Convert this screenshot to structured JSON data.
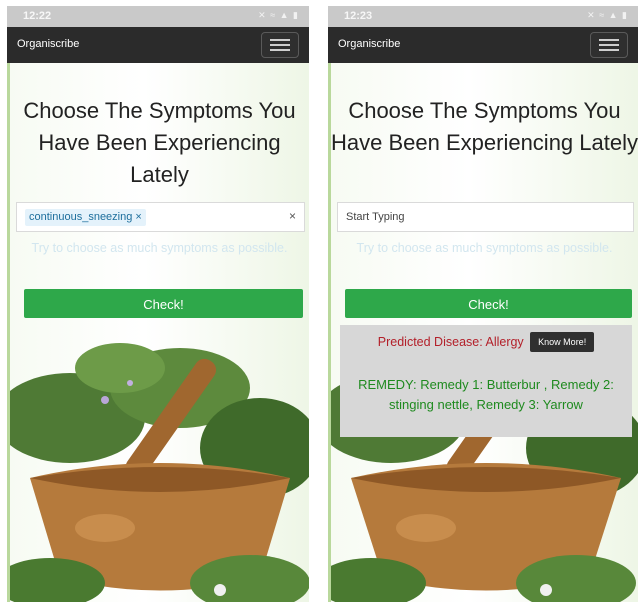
{
  "left_screen": {
    "status_time": "12:22",
    "brand": "Organiscribe",
    "heading": "Choose The Symptoms You Have Been Experiencing Lately",
    "selected_symptom": "continuous_sneezing ×",
    "clear_symbol": "×",
    "hint": "Try to choose as much symptoms as possible.",
    "check_label": "Check!"
  },
  "right_screen": {
    "status_time": "12:23",
    "brand": "Organiscribe",
    "heading": "Choose The Symptoms You Have Been Experiencing Lately",
    "placeholder": "Start Typing",
    "hint": "Try to choose as much symptoms as possible.",
    "check_label": "Check!",
    "predicted_disease": "Predicted Disease: Allergy",
    "know_more_label": "Know More!",
    "remedy": "REMEDY: Remedy 1: Butterbur , Remedy 2: stinging nettle, Remedy 3: Yarrow"
  },
  "icons": {
    "status": "signal-wifi-battery-icons",
    "menu": "hamburger-menu-icon",
    "hero": "mortar-pestle-herbs-image"
  },
  "colors": {
    "navbar": "#2b2b2b",
    "check_button": "#2ea84a",
    "predicted_text": "#b3202a",
    "remedy_text": "#1f8a1f",
    "chip_bg": "#e4f2fb"
  }
}
